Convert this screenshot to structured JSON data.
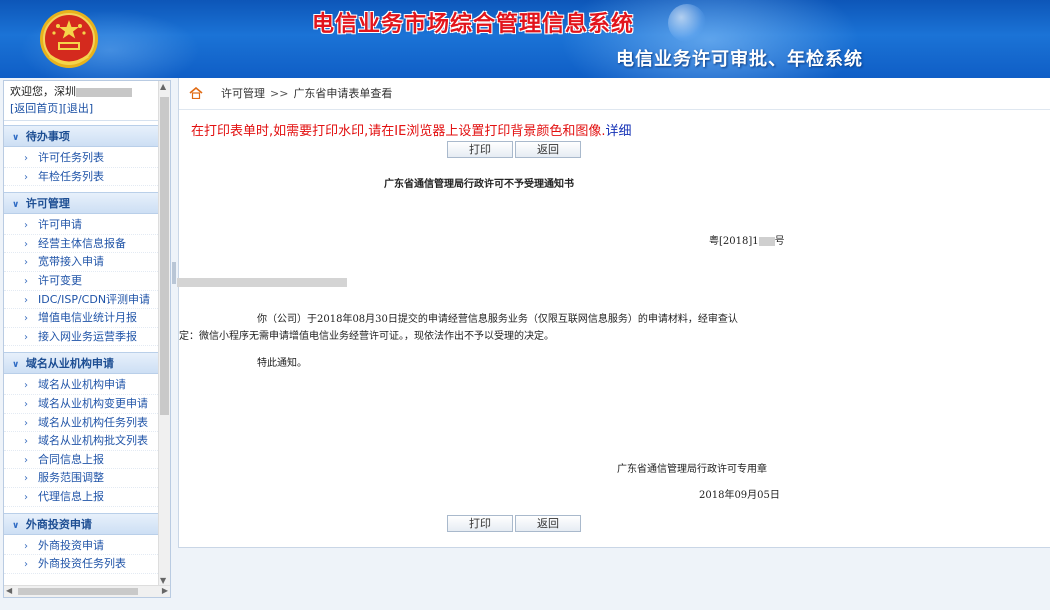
{
  "header": {
    "main_title": "电信业务市场综合管理信息系统",
    "sub_title": "电信业务许可审批、年检系统"
  },
  "user": {
    "greeting": "欢迎您，深圳",
    "home_link": "[返回首页]",
    "logout_link": "[退出]"
  },
  "sidebar": {
    "groups": [
      {
        "title": "待办事项",
        "items": [
          "许可任务列表",
          "年检任务列表"
        ]
      },
      {
        "title": "许可管理",
        "items": [
          "许可申请",
          "经营主体信息报备",
          "宽带接入申请",
          "许可变更",
          "IDC/ISP/CDN评测申请",
          "增值电信业统计月报",
          "接入网业务运营季报"
        ]
      },
      {
        "title": "域名从业机构申请",
        "items": [
          "域名从业机构申请",
          "域名从业机构变更申请",
          "域名从业机构任务列表",
          "域名从业机构批文列表",
          "合同信息上报",
          "服务范围调整",
          "代理信息上报"
        ]
      },
      {
        "title": "外商投资申请",
        "items": [
          "外商投资申请",
          "外商投资任务列表"
        ]
      }
    ]
  },
  "breadcrumb": {
    "root": "许可管理",
    "separator": ">>",
    "current": "广东省申请表单查看"
  },
  "notice": {
    "text": "在打印表单时,如需要打印水印,请在IE浏览器上设置打印背景颜色和图像.",
    "detail_link": "详细"
  },
  "buttons": {
    "print": "打印",
    "back": "返回"
  },
  "document": {
    "title": "广东省通信管理局行政许可不予受理通知书",
    "number_prefix": "粤[2018]1",
    "number_suffix": "号",
    "body_line1": "你（公司）于2018年08月30日提交的申请经营信息服务业务（仅限互联网信息服务）的申请材料，经审查认",
    "body_line2": "定：微信小程序无需申请增值电信业务经营许可证。，现依法作出不予以受理的决定。",
    "closing": "特此通知。",
    "signer": "广东省通信管理局行政许可专用章",
    "date": "2018年09月05日"
  },
  "colors": {
    "header_blue": "#1b73d6",
    "title_red": "#e2151c",
    "notice_red": "#e21010",
    "link_blue": "#1532b6"
  }
}
